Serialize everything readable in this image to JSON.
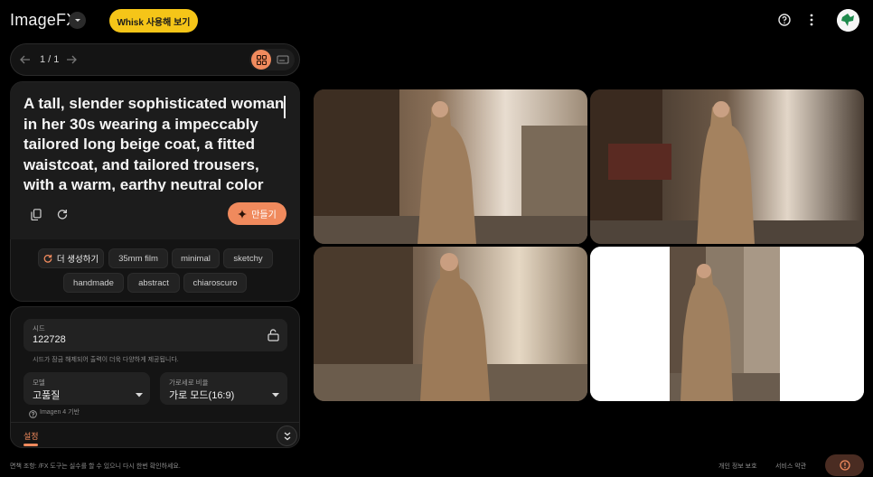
{
  "header": {
    "app_title": "ImageFX",
    "whisk_button": "Whisk 사용해 보기",
    "help_icon": "help-circle-icon",
    "more_icon": "more-vert-icon",
    "avatar_icon": "user-avatar"
  },
  "nav": {
    "page_indicator": "1 / 1",
    "prev_icon": "arrow-left-icon",
    "next_icon": "arrow-right-icon",
    "grid_view_icon": "grid-view-icon",
    "single_view_icon": "single-view-icon"
  },
  "prompt": {
    "text": "A tall, slender sophisticated woman in her 30s wearing a impeccably tailored long beige coat, a fitted waistcoat, and tailored trousers, with a warm, earthy neutral color palette",
    "make_button": "만들기"
  },
  "chips": {
    "regenerate": "더 생성하기",
    "items": [
      "35mm film",
      "minimal",
      "sketchy",
      "handmade",
      "abstract",
      "chiaroscuro"
    ]
  },
  "settings": {
    "seed_label": "시드",
    "seed_value": "122728",
    "seed_hint": "시드가 잠금 해제되어 출력이 더욱 다양하게 제공됩니다.",
    "model_label": "모델",
    "model_value": "고품질",
    "ratio_label": "가로세로 비율",
    "ratio_value": "가로 모드(16:9)",
    "model_note": "Imagen 4 기반",
    "settings_tab": "설정"
  },
  "footer": {
    "disclaimer": "면책 조항: /FX 도구는 실수를 할 수 있으니 다시 한번 확인하세요.",
    "privacy": "개인 정보 보호",
    "terms": "서비스 약관"
  },
  "colors": {
    "accent": "#f08a5d",
    "whisk": "#f5c518",
    "background": "#000000"
  },
  "images": [
    "generated-image-1",
    "generated-image-2",
    "generated-image-3",
    "generated-image-4"
  ]
}
